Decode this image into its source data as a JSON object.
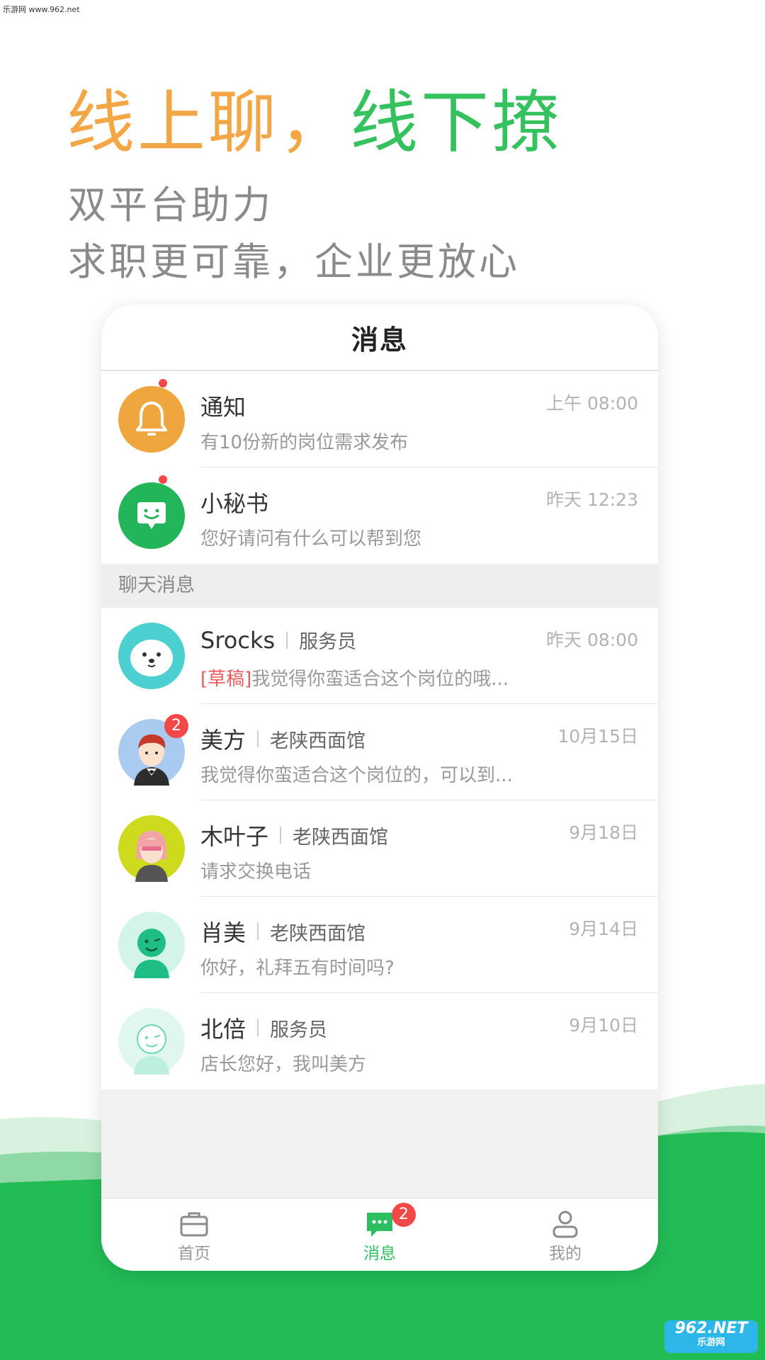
{
  "watermark": "乐游网 www.962.net",
  "hero": {
    "title_part1": "线上聊，",
    "title_part2": "线下撩",
    "subtitle_line1": "双平台助力",
    "subtitle_line2": "求职更可靠，企业更放心"
  },
  "colors": {
    "accent_orange": "#F2A645",
    "accent_green": "#35C25E",
    "badge_red": "#F24848",
    "bottom_green": "#22BC55"
  },
  "app": {
    "header_title": "消息",
    "system_items": [
      {
        "name": "通知",
        "time": "上午  08:00",
        "preview": "有10份新的岗位需求发布",
        "icon": "bell-icon",
        "unread_dot": true
      },
      {
        "name": "小秘书",
        "time": "昨天  12:23",
        "preview": "您好请问有什么可以帮到您",
        "icon": "chat-bubble-icon",
        "unread_dot": true
      }
    ],
    "section_label": "聊天消息",
    "chats": [
      {
        "name": "Srocks",
        "role": "服务员",
        "time": "昨天  08:00",
        "draft_tag": "[草稿]",
        "preview": "我觉得你蛮适合这个岗位的哦...",
        "avatar": "seal-avatar"
      },
      {
        "name": "美方",
        "role": "老陕西面馆",
        "time": "10月15日",
        "badge": "2",
        "preview": "我觉得你蛮适合这个岗位的，可以到...",
        "avatar": "man-avatar"
      },
      {
        "name": "木叶子",
        "role": "老陕西面馆",
        "time": "9月18日",
        "preview": "请求交换电话",
        "avatar": "girl-avatar"
      },
      {
        "name": "肖美",
        "role": "老陕西面馆",
        "time": "9月14日",
        "preview": "你好，礼拜五有时间吗?",
        "avatar": "green-person-avatar"
      },
      {
        "name": "北倍",
        "role": "服务员",
        "time": "9月10日",
        "preview": "店长您好，我叫美方",
        "avatar": "light-person-avatar"
      }
    ],
    "tabs": [
      {
        "label": "首页",
        "icon": "briefcase-icon",
        "active": false
      },
      {
        "label": "消息",
        "icon": "message-icon",
        "active": true,
        "badge": "2"
      },
      {
        "label": "我的",
        "icon": "user-icon",
        "active": false
      }
    ]
  },
  "logo": {
    "line1": "962.NET",
    "line2": "乐游网"
  }
}
